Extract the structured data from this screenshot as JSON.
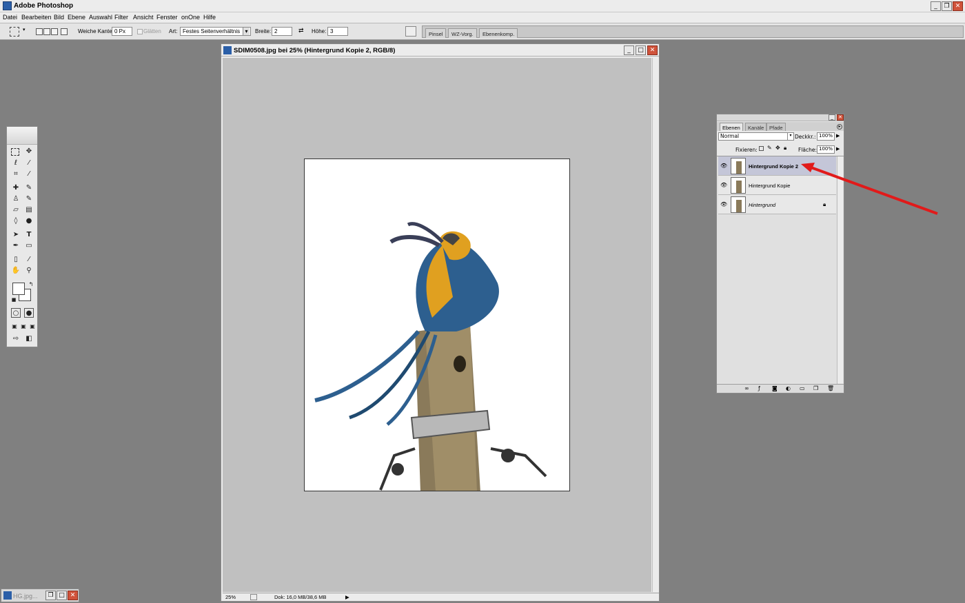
{
  "app": {
    "title": "Adobe Photoshop"
  },
  "menu": [
    "Datei",
    "Bearbeiten",
    "Bild",
    "Ebene",
    "Auswahl",
    "Filter",
    "Ansicht",
    "Fenster",
    "onOne",
    "Hilfe"
  ],
  "options": {
    "feather_label": "Weiche Kante:",
    "feather_value": "0 Px",
    "antialias_label": "Glätten",
    "style_label": "Art:",
    "style_value": "Festes Seitenverhältnis",
    "width_label": "Breite:",
    "width_value": "2",
    "height_label": "Höhe:",
    "height_value": "3"
  },
  "palette_well": [
    "Pinsel",
    "WZ-Vorg.",
    "Ebenenkomp."
  ],
  "document": {
    "title": "SDIM0508.jpg bei 25% (Hintergrund Kopie 2, RGB/8)",
    "zoom": "25%",
    "doc_info": "Dok: 16,0 MB/38,6 MB"
  },
  "layers_panel": {
    "tabs": [
      "Ebenen",
      "Kanäle",
      "Pfade"
    ],
    "blend_mode": "Normal",
    "opacity_label": "Deckkr.:",
    "opacity_value": "100%",
    "lock_label": "Fixieren:",
    "fill_label": "Fläche:",
    "fill_value": "100%",
    "layers": [
      {
        "name": "Hintergrund Kopie 2",
        "selected": true
      },
      {
        "name": "Hintergrund Kopie",
        "selected": false
      },
      {
        "name": "Hintergrund",
        "selected": false,
        "locked": true
      }
    ]
  },
  "taskbar": {
    "minimized_doc": "HG.jpg..."
  },
  "colors": {
    "annotation_arrow": "#e11a1a",
    "workspace": "#808080"
  }
}
